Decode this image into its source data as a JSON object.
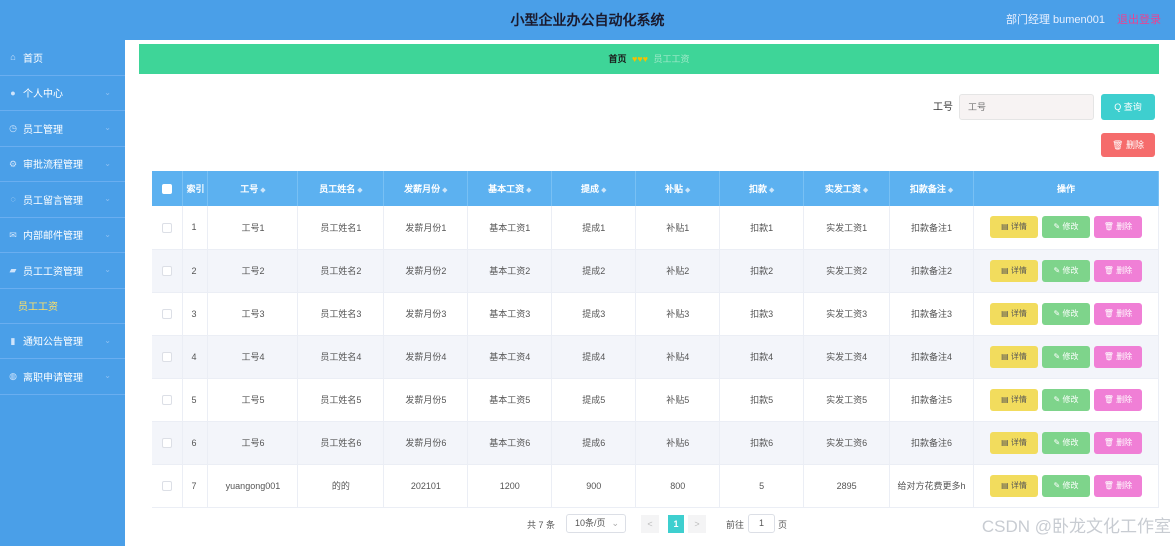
{
  "header": {
    "title": "小型企业办公自动化系统",
    "user": "部门经理 bumen001",
    "logout": "退出登录"
  },
  "sidebar": {
    "items": [
      {
        "label": "首页",
        "icon": "home-icon",
        "glyph": "⌂",
        "chevron": false
      },
      {
        "label": "个人中心",
        "icon": "user-icon",
        "glyph": "●",
        "chevron": true
      },
      {
        "label": "员工管理",
        "icon": "clock-icon",
        "glyph": "◷",
        "chevron": true
      },
      {
        "label": "审批流程管理",
        "icon": "gear-icon",
        "glyph": "⚙",
        "chevron": true
      },
      {
        "label": "员工留言管理",
        "icon": "message-icon",
        "glyph": "◌",
        "chevron": true
      },
      {
        "label": "内部邮件管理",
        "icon": "mail-icon",
        "glyph": "✉",
        "chevron": true
      },
      {
        "label": "员工工资管理",
        "icon": "money-icon",
        "glyph": "▰",
        "chevron": true
      },
      {
        "label": "员工工资",
        "sub": true
      },
      {
        "label": "通知公告管理",
        "icon": "chart-icon",
        "glyph": "▮",
        "chevron": true
      },
      {
        "label": "离职申请管理",
        "icon": "doc-icon",
        "glyph": "◍",
        "chevron": true
      }
    ]
  },
  "breadcrumb": {
    "home": "首页",
    "separator": "♥♥♥",
    "current": "员工工资"
  },
  "search": {
    "label": "工号",
    "placeholder": "工号",
    "button": "Q 查询"
  },
  "toolbar": {
    "delete": "🗑 删除"
  },
  "table": {
    "headers": [
      "索引",
      "工号",
      "员工姓名",
      "发薪月份",
      "基本工资",
      "提成",
      "补贴",
      "扣款",
      "实发工资",
      "扣款备注",
      "操作"
    ],
    "sort_glyph": "◆",
    "rows": [
      [
        "1",
        "工号1",
        "员工姓名1",
        "发薪月份1",
        "基本工资1",
        "提成1",
        "补贴1",
        "扣款1",
        "实发工资1",
        "扣款备注1"
      ],
      [
        "2",
        "工号2",
        "员工姓名2",
        "发薪月份2",
        "基本工资2",
        "提成2",
        "补贴2",
        "扣款2",
        "实发工资2",
        "扣款备注2"
      ],
      [
        "3",
        "工号3",
        "员工姓名3",
        "发薪月份3",
        "基本工资3",
        "提成3",
        "补贴3",
        "扣款3",
        "实发工资3",
        "扣款备注3"
      ],
      [
        "4",
        "工号4",
        "员工姓名4",
        "发薪月份4",
        "基本工资4",
        "提成4",
        "补贴4",
        "扣款4",
        "实发工资4",
        "扣款备注4"
      ],
      [
        "5",
        "工号5",
        "员工姓名5",
        "发薪月份5",
        "基本工资5",
        "提成5",
        "补贴5",
        "扣款5",
        "实发工资5",
        "扣款备注5"
      ],
      [
        "6",
        "工号6",
        "员工姓名6",
        "发薪月份6",
        "基本工资6",
        "提成6",
        "补贴6",
        "扣款6",
        "实发工资6",
        "扣款备注6"
      ],
      [
        "7",
        "yuangong001",
        "的的",
        "202101",
        "1200",
        "900",
        "800",
        "5",
        "2895",
        "给对方花费更多h"
      ]
    ],
    "actions": {
      "detail": "▤ 详情",
      "edit": "✎ 修改",
      "delete": "🗑 删除"
    }
  },
  "pagination": {
    "total": "共 7 条",
    "page_size": "10条/页",
    "page": "1",
    "goto": "前往",
    "goto_value": "1",
    "page_label": "页",
    "prev": "<",
    "next": ">",
    "dropdown": "⌄"
  },
  "watermark": "CSDN @卧龙文化工作室"
}
